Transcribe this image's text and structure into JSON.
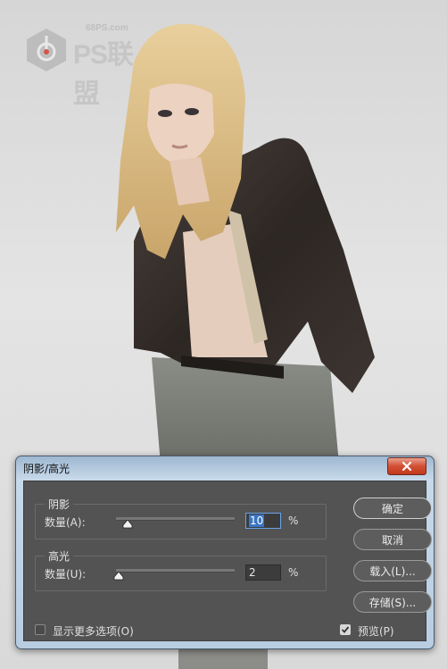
{
  "watermark": {
    "site": "68PS.com",
    "brand": "PS联盟"
  },
  "dialog": {
    "title": "阴影/高光",
    "shadows": {
      "legend": "阴影",
      "amount_label": "数量(A):",
      "amount_value": "10",
      "amount_fraction": 0.1,
      "unit": "%"
    },
    "highlights": {
      "legend": "高光",
      "amount_label": "数量(U):",
      "amount_value": "2",
      "amount_fraction": 0.02,
      "unit": "%"
    },
    "buttons": {
      "ok": "确定",
      "cancel": "取消",
      "load": "载入(L)...",
      "save": "存储(S)..."
    },
    "show_more_options": {
      "label": "显示更多选项(O)",
      "checked": false
    },
    "preview": {
      "label": "预览(P)",
      "checked": true
    }
  },
  "colors": {
    "dialog_client": "#535353",
    "title_bar": "#b8cde2",
    "close_button": "#d24f33",
    "selection": "#3a75c4"
  }
}
